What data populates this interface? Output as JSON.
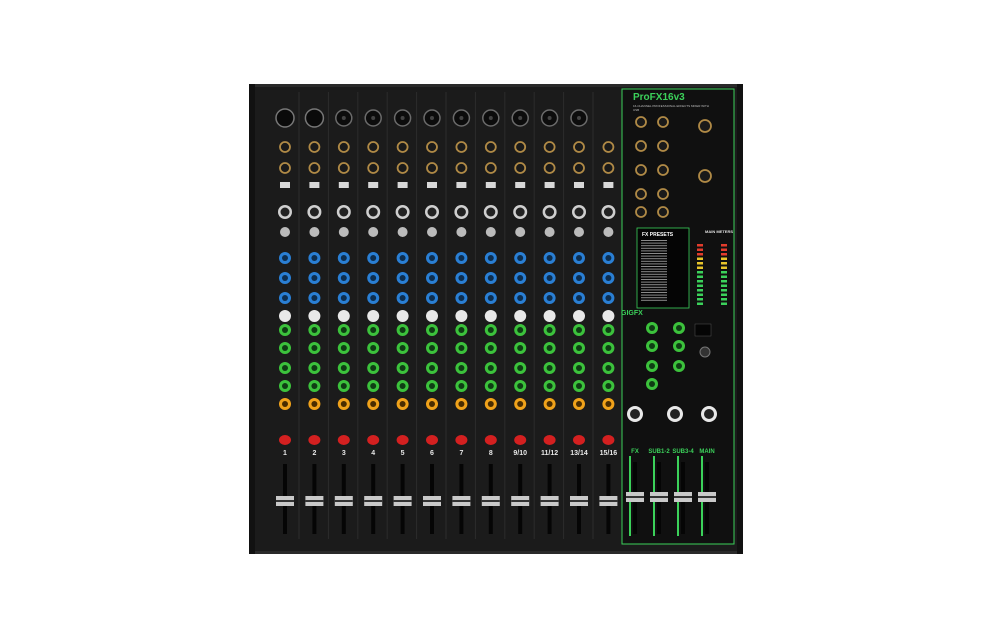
{
  "product": {
    "name": "ProFX16v3",
    "subtitle": "16-CHANNEL PROFESSIONAL EFFECTS MIXER WITH USB"
  },
  "sections": {
    "fx_presets": "FX PRESETS",
    "gigfx": "GIGFX",
    "main_meters": "MAIN METERS"
  },
  "channels": [
    "1",
    "2",
    "3",
    "4",
    "5",
    "6",
    "7",
    "8",
    "9/10",
    "11/12",
    "13/14",
    "15/16"
  ],
  "master_faders": [
    "FX",
    "SUB1-2",
    "SUB3-4",
    "MAIN"
  ],
  "colors": {
    "panel": "#1b1b1b",
    "frame": "#2a2a2a",
    "accent": "#3bd15a",
    "eq_knob": "#2a7fd4",
    "aux_knob": "#3cc23c",
    "pan_knob": "#f0a21a",
    "mute": "#d42020"
  }
}
